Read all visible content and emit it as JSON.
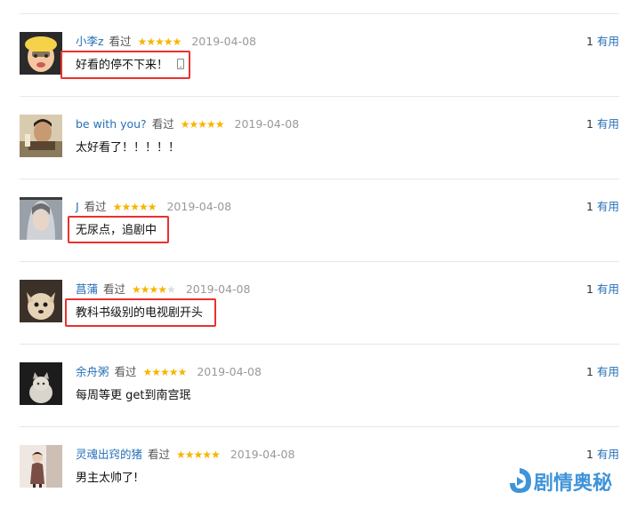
{
  "comments": [
    {
      "username": "小李z",
      "watched_label": "看过",
      "rating": 5,
      "stars": [
        "★",
        "★",
        "★",
        "★",
        "★"
      ],
      "date": "2019-04-08",
      "text": "好看的停不下来！",
      "has_phone_icon": true,
      "votes": "1",
      "useful_label": "有用",
      "highlighted": true,
      "avatar": "avatar-photo"
    },
    {
      "username": "be with you?",
      "watched_label": "看过",
      "rating": 5,
      "stars": [
        "★",
        "★",
        "★",
        "★",
        "★"
      ],
      "date": "2019-04-08",
      "text": "太好看了！！！！！",
      "has_phone_icon": false,
      "votes": "1",
      "useful_label": "有用",
      "highlighted": false,
      "avatar": "avatar-photo"
    },
    {
      "username": "J",
      "watched_label": "看过",
      "rating": 5,
      "stars": [
        "★",
        "★",
        "★",
        "★",
        "★"
      ],
      "date": "2019-04-08",
      "text": "无尿点，追剧中",
      "has_phone_icon": false,
      "votes": "1",
      "useful_label": "有用",
      "highlighted": true,
      "avatar": "avatar-photo"
    },
    {
      "username": "菖蒲",
      "watched_label": "看过",
      "rating": 4,
      "stars": [
        "★",
        "★",
        "★",
        "★",
        "★"
      ],
      "date": "2019-04-08",
      "text": "教科书级别的电视剧开头",
      "has_phone_icon": false,
      "votes": "1",
      "useful_label": "有用",
      "highlighted": true,
      "avatar": "avatar-photo"
    },
    {
      "username": "余舟粥",
      "watched_label": "看过",
      "rating": 5,
      "stars": [
        "★",
        "★",
        "★",
        "★",
        "★"
      ],
      "date": "2019-04-08",
      "text": "每周等更 get到南宫珉",
      "has_phone_icon": false,
      "votes": "1",
      "useful_label": "有用",
      "highlighted": false,
      "avatar": "avatar-photo"
    },
    {
      "username": "灵魂出窍的猪",
      "watched_label": "看过",
      "rating": 5,
      "stars": [
        "★",
        "★",
        "★",
        "★",
        "★"
      ],
      "date": "2019-04-08",
      "text": "男主太帅了!",
      "has_phone_icon": false,
      "votes": "1",
      "useful_label": "有用",
      "highlighted": false,
      "avatar": "avatar-photo"
    }
  ],
  "colors": {
    "username": "#2570b7",
    "star_on": "#f7b500",
    "star_off": "#dcdcdc",
    "date": "#999999",
    "highlight_border": "#e8322f",
    "watermark": "#3f94d9"
  },
  "watermark": {
    "text": "剧情奥秘",
    "icon": "play-logo-icon"
  }
}
